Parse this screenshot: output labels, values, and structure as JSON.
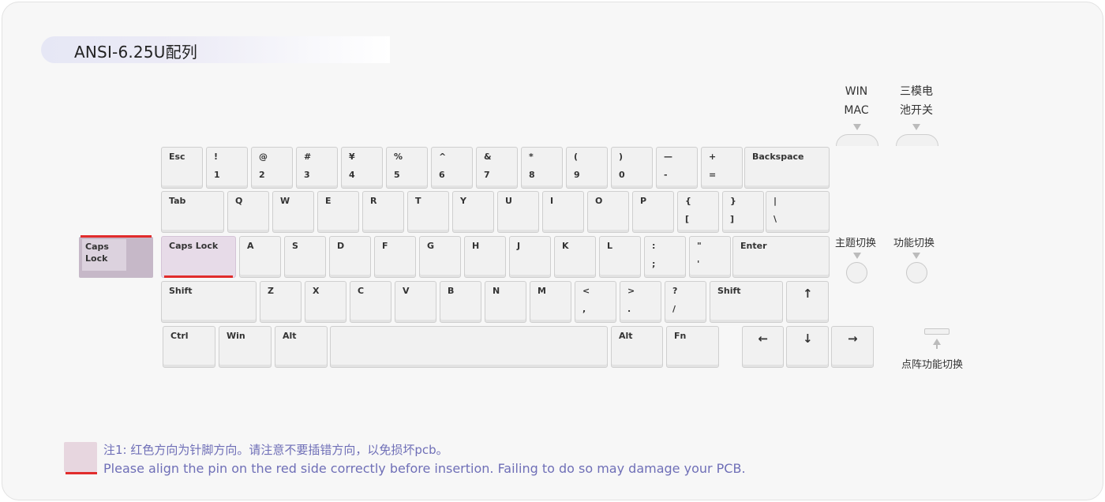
{
  "title": "ANSI-6.25U配列",
  "rows": [
    [
      {
        "l1": "Esc",
        "l2": ""
      },
      {
        "l1": "!",
        "l2": "1"
      },
      {
        "l1": "@",
        "l2": "2"
      },
      {
        "l1": "#",
        "l2": "3"
      },
      {
        "l1": "¥",
        "l2": "4"
      },
      {
        "l1": "%",
        "l2": "5"
      },
      {
        "l1": "^",
        "l2": "6"
      },
      {
        "l1": "&",
        "l2": "7"
      },
      {
        "l1": "*",
        "l2": "8"
      },
      {
        "l1": "(",
        "l2": "9"
      },
      {
        "l1": ")",
        "l2": "0"
      },
      {
        "l1": "—",
        "l2": "-"
      },
      {
        "l1": "+",
        "l2": "="
      },
      {
        "l1": "Backspace",
        "l2": ""
      }
    ],
    [
      {
        "l1": "Tab",
        "l2": ""
      },
      {
        "l1": "Q",
        "l2": ""
      },
      {
        "l1": "W",
        "l2": ""
      },
      {
        "l1": "E",
        "l2": ""
      },
      {
        "l1": "R",
        "l2": ""
      },
      {
        "l1": "T",
        "l2": ""
      },
      {
        "l1": "Y",
        "l2": ""
      },
      {
        "l1": "U",
        "l2": ""
      },
      {
        "l1": "I",
        "l2": ""
      },
      {
        "l1": "O",
        "l2": ""
      },
      {
        "l1": "P",
        "l2": ""
      },
      {
        "l1": "{",
        "l2": "["
      },
      {
        "l1": "}",
        "l2": "]"
      },
      {
        "l1": "|",
        "l2": "\\"
      }
    ],
    [
      {
        "l1": "Caps Lock",
        "l2": ""
      },
      {
        "l1": "A",
        "l2": ""
      },
      {
        "l1": "S",
        "l2": ""
      },
      {
        "l1": "D",
        "l2": ""
      },
      {
        "l1": "F",
        "l2": ""
      },
      {
        "l1": "G",
        "l2": ""
      },
      {
        "l1": "H",
        "l2": ""
      },
      {
        "l1": "J",
        "l2": ""
      },
      {
        "l1": "K",
        "l2": ""
      },
      {
        "l1": "L",
        "l2": ""
      },
      {
        "l1": ":",
        "l2": ";"
      },
      {
        "l1": "\"",
        "l2": "'"
      },
      {
        "l1": "Enter",
        "l2": ""
      }
    ],
    [
      {
        "l1": "Shift",
        "l2": ""
      },
      {
        "l1": "Z",
        "l2": ""
      },
      {
        "l1": "X",
        "l2": ""
      },
      {
        "l1": "C",
        "l2": ""
      },
      {
        "l1": "V",
        "l2": ""
      },
      {
        "l1": "B",
        "l2": ""
      },
      {
        "l1": "N",
        "l2": ""
      },
      {
        "l1": "M",
        "l2": ""
      },
      {
        "l1": "<",
        "l2": ","
      },
      {
        "l1": ">",
        "l2": "."
      },
      {
        "l1": "?",
        "l2": "/"
      },
      {
        "l1": "Shift",
        "l2": ""
      },
      {
        "l1": "↑",
        "l2": ""
      }
    ],
    [
      {
        "l1": "Ctrl",
        "l2": ""
      },
      {
        "l1": "Win",
        "l2": ""
      },
      {
        "l1": "Alt",
        "l2": ""
      },
      {
        "l1": "",
        "l2": ""
      },
      {
        "l1": "Alt",
        "l2": ""
      },
      {
        "l1": "Fn",
        "l2": ""
      },
      {
        "l1": "←",
        "l2": ""
      },
      {
        "l1": "↓",
        "l2": ""
      },
      {
        "l1": "→",
        "l2": ""
      }
    ]
  ],
  "detached_key": "Caps Lock",
  "switches": {
    "os_label_1": "WIN",
    "os_label_2": "MAC",
    "mode_label_1": "三模电",
    "mode_label_2": "池开关",
    "theme_label": "主题切换",
    "function_label": "功能切换",
    "matrix_label": "点阵功能切换"
  },
  "note": {
    "cn": "注1: 红色方向为针脚方向。请注意不要插错方向，以免损坏pcb。",
    "en": "Please align the pin on the red side correctly before insertion. Failing to do so may damage your PCB."
  },
  "colors": {
    "pin_indicator": "#e12c2c",
    "note_text": "#6f6fb7",
    "caps_key": "#e7dbe8"
  }
}
